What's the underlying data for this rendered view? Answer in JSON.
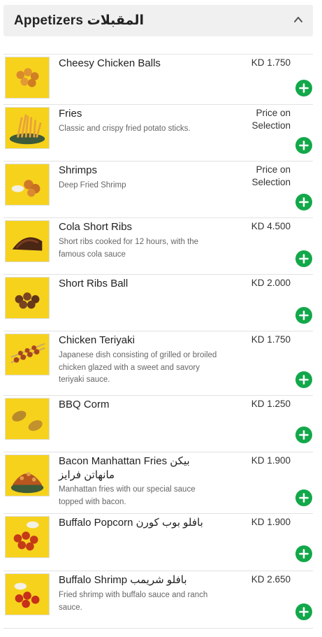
{
  "section": {
    "title": "Appetizers المقبلات",
    "collapse_icon": "chevron-up-icon"
  },
  "colors": {
    "add_button": "#12a84a",
    "thumbnail_background": "#f7d21c",
    "header_background": "#f0f0f0"
  },
  "items": [
    {
      "name": "Cheesy Chicken Balls",
      "description": "",
      "price": "KD 1.750",
      "image": "cheesy-chicken-balls-photo"
    },
    {
      "name": "Fries",
      "description": "Classic and crispy fried potato sticks.",
      "price": "Price on Selection",
      "image": "fries-photo"
    },
    {
      "name": "Shrimps",
      "description": "Deep Fried Shrimp",
      "price": "Price on Selection",
      "image": "shrimps-photo"
    },
    {
      "name": "Cola Short Ribs",
      "description": "Short ribs cooked for 12 hours, with the famous cola sauce",
      "price": "KD 4.500",
      "image": "cola-short-ribs-photo"
    },
    {
      "name": "Short Ribs Ball",
      "description": "",
      "price": "KD 2.000",
      "image": "short-ribs-ball-photo"
    },
    {
      "name": "Chicken Teriyaki",
      "description": "Japanese dish consisting of grilled or broiled chicken glazed with a sweet and savory teriyaki sauce.",
      "price": "KD 1.750",
      "image": "chicken-teriyaki-photo"
    },
    {
      "name": "BBQ Corm",
      "description": "",
      "price": "KD 1.250",
      "image": "bbq-corn-photo"
    },
    {
      "name": "Bacon Manhattan Fries بيكن مانهاتن فرايز",
      "description": "Manhattan fries with our special sauce topped with bacon.",
      "price": "KD 1.900",
      "image": "bacon-manhattan-fries-photo"
    },
    {
      "name": "Buffalo Popcorn بافلو بوب كورن",
      "description": "",
      "price": "KD 1.900",
      "image": "buffalo-popcorn-photo"
    },
    {
      "name": "Buffalo Shrimp بافلو شريمب",
      "description": "Fried shrimp with buffalo sauce and ranch sauce.",
      "price": "KD 2.650",
      "image": "buffalo-shrimp-photo"
    }
  ]
}
